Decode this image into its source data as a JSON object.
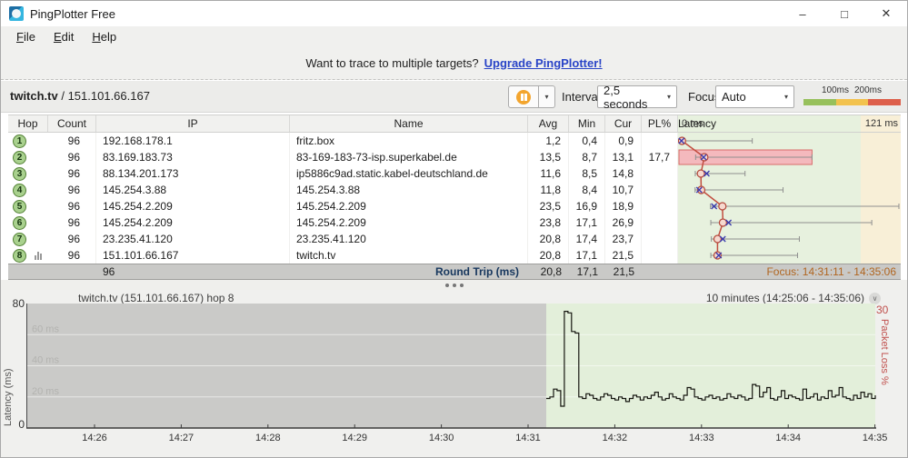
{
  "window": {
    "title": "PingPlotter Free"
  },
  "icons": {
    "minimize": "–",
    "maximize": "□",
    "close": "✕",
    "dropdown": "▾",
    "chevron": "∨"
  },
  "menu": {
    "items": [
      "File",
      "Edit",
      "Help"
    ]
  },
  "banner": {
    "text": "Want to trace to multiple targets?",
    "link": "Upgrade PingPlotter!"
  },
  "target": {
    "host": "twitch.tv",
    "separator": " / ",
    "ip": "151.101.66.167"
  },
  "controls": {
    "interval_label": "Interval",
    "interval_value": "2,5 seconds",
    "focus_label": "Focus",
    "focus_value": "Auto",
    "legend": {
      "labels": [
        "100ms",
        "200ms"
      ],
      "colors": [
        "#97c05c",
        "#f2c24e",
        "#dd5f4b"
      ]
    }
  },
  "table": {
    "headers": [
      "Hop",
      "Count",
      "IP",
      "Name",
      "Avg",
      "Min",
      "Cur",
      "PL%"
    ],
    "latency_header": {
      "left": "0 ms",
      "title": "Latency",
      "right": "121 ms"
    },
    "rows": [
      {
        "hop": "1",
        "count": "96",
        "ip": "192.168.178.1",
        "name": "fritz.box",
        "avg": "1,2",
        "min": "0,4",
        "cur": "0,9",
        "pl": "",
        "has_graph_icon": false
      },
      {
        "hop": "2",
        "count": "96",
        "ip": "83.169.183.73",
        "name": "83-169-183-73-isp.superkabel.de",
        "avg": "13,5",
        "min": "8,7",
        "cur": "13,1",
        "pl": "17,7",
        "has_graph_icon": false
      },
      {
        "hop": "3",
        "count": "96",
        "ip": "88.134.201.173",
        "name": "ip5886c9ad.static.kabel-deutschland.de",
        "avg": "11,6",
        "min": "8,5",
        "cur": "14,8",
        "pl": "",
        "has_graph_icon": false
      },
      {
        "hop": "4",
        "count": "96",
        "ip": "145.254.3.88",
        "name": "145.254.3.88",
        "avg": "11,8",
        "min": "8,4",
        "cur": "10,7",
        "pl": "",
        "has_graph_icon": false
      },
      {
        "hop": "5",
        "count": "96",
        "ip": "145.254.2.209",
        "name": "145.254.2.209",
        "avg": "23,5",
        "min": "16,9",
        "cur": "18,9",
        "pl": "",
        "has_graph_icon": false
      },
      {
        "hop": "6",
        "count": "96",
        "ip": "145.254.2.209",
        "name": "145.254.2.209",
        "avg": "23,8",
        "min": "17,1",
        "cur": "26,9",
        "pl": "",
        "has_graph_icon": false
      },
      {
        "hop": "7",
        "count": "96",
        "ip": "23.235.41.120",
        "name": "23.235.41.120",
        "avg": "20,8",
        "min": "17,4",
        "cur": "23,7",
        "pl": "",
        "has_graph_icon": false
      },
      {
        "hop": "8",
        "count": "96",
        "ip": "151.101.66.167",
        "name": "twitch.tv",
        "avg": "20,8",
        "min": "17,1",
        "cur": "21,5",
        "pl": "",
        "has_graph_icon": true
      }
    ],
    "round_trip": {
      "count": "96",
      "label": "Round Trip (ms)",
      "avg": "20,8",
      "min": "17,1",
      "cur": "21,5",
      "focus": "Focus: 14:31:11 - 14:35:06"
    }
  },
  "timeline": {
    "title": "twitch.tv (151.101.66.167) hop 8",
    "period": "10 minutes (14:25:06 - 14:35:06)",
    "y_top": "80",
    "y_bottom": "0",
    "y2_top": "30",
    "ylabel": "Latency (ms)",
    "y2label": "Packet Loss %"
  },
  "chart_data": [
    {
      "type": "scatter",
      "title": "Per-hop latency, min/avg/cur with min-max range bars",
      "xlabel": "Latency (ms)",
      "xlim": [
        0,
        121
      ],
      "legend_position": "none",
      "series": [
        {
          "name": "hop 1",
          "avg": 1.2,
          "min": 0.4,
          "cur": 0.9,
          "max": 40
        },
        {
          "name": "hop 2",
          "avg": 13.5,
          "min": 8.7,
          "cur": 13.1,
          "max": 73,
          "loss_extent": 73,
          "pl_pct": 17.7
        },
        {
          "name": "hop 3",
          "avg": 11.6,
          "min": 8.5,
          "cur": 14.8,
          "max": 36
        },
        {
          "name": "hop 4",
          "avg": 11.8,
          "min": 8.4,
          "cur": 10.7,
          "max": 57
        },
        {
          "name": "hop 5",
          "avg": 23.5,
          "min": 16.9,
          "cur": 18.9,
          "max": 123
        },
        {
          "name": "hop 6",
          "avg": 23.8,
          "min": 17.1,
          "cur": 26.9,
          "max": 106
        },
        {
          "name": "hop 7",
          "avg": 20.8,
          "min": 17.4,
          "cur": 23.7,
          "max": 66
        },
        {
          "name": "hop 8",
          "avg": 20.8,
          "min": 17.1,
          "cur": 21.5,
          "max": 65
        }
      ]
    },
    {
      "type": "line",
      "title": "twitch.tv (151.101.66.167) hop 8",
      "ylabel": "Latency (ms)",
      "ylim": [
        0,
        80
      ],
      "y2label": "Packet Loss %",
      "y2lim": [
        0,
        30
      ],
      "grid": true,
      "grid_labels": [
        "60 ms",
        "40 ms",
        "20 ms"
      ],
      "x_ticks": [
        "14:26",
        "14:27",
        "14:28",
        "14:29",
        "14:30",
        "14:31",
        "14:32",
        "14:33",
        "14:34",
        "14:35"
      ],
      "focus_x_frac": 0.612,
      "values": [
        19,
        20,
        25,
        24,
        14,
        75,
        74,
        62,
        61,
        20,
        19,
        22,
        21,
        19,
        18,
        20,
        22,
        21,
        19,
        18,
        20,
        19,
        17,
        19,
        21,
        20,
        18,
        20,
        19,
        21,
        23,
        20,
        18,
        19,
        22,
        20,
        19,
        18,
        21,
        26,
        25,
        20,
        19,
        18,
        20,
        21,
        19,
        20,
        18,
        19,
        22,
        20,
        19,
        21,
        20,
        18,
        19,
        28,
        27,
        20,
        23,
        26,
        19,
        18,
        20,
        24,
        19,
        21,
        20,
        19,
        18,
        25,
        19,
        20,
        22,
        18,
        20,
        19,
        24,
        20,
        21,
        26,
        20,
        19,
        18,
        21,
        19,
        23,
        20,
        22,
        19,
        21
      ]
    }
  ]
}
